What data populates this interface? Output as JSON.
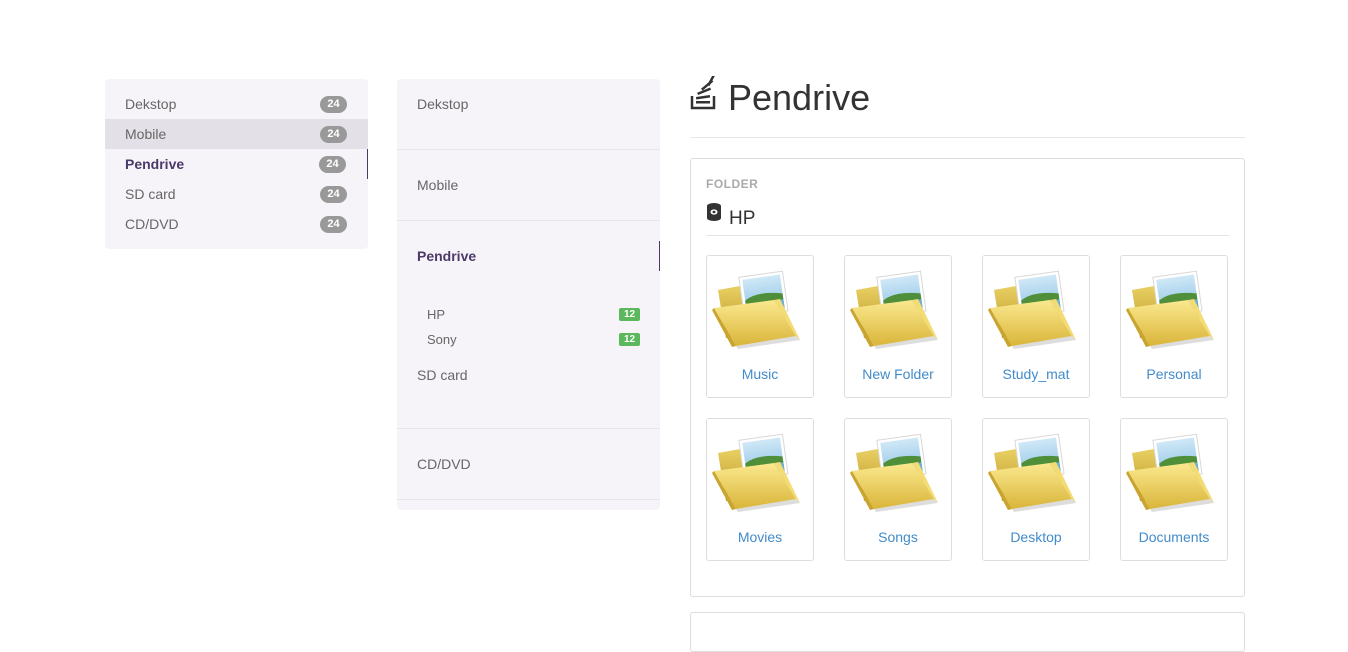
{
  "nav_primary": {
    "items": [
      {
        "label": "Dekstop",
        "badge": "24"
      },
      {
        "label": "Mobile",
        "badge": "24"
      },
      {
        "label": "Pendrive",
        "badge": "24"
      },
      {
        "label": "SD card",
        "badge": "24"
      },
      {
        "label": "CD/DVD",
        "badge": "24"
      }
    ]
  },
  "nav_secondary": {
    "items": [
      {
        "label": "Dekstop"
      },
      {
        "label": "Mobile"
      },
      {
        "label": "Pendrive"
      },
      {
        "label": "SD card"
      },
      {
        "label": "CD/DVD"
      }
    ],
    "subitems": [
      {
        "label": "HP",
        "badge": "12"
      },
      {
        "label": "Sony",
        "badge": "12"
      }
    ]
  },
  "page": {
    "title": "Pendrive",
    "title_icon": "stack-icon"
  },
  "folder_panel": {
    "label": "FOLDER",
    "heading": "HP",
    "heading_icon": "database-icon",
    "folders": [
      {
        "label": "Music"
      },
      {
        "label": "New Folder"
      },
      {
        "label": "Study_mat"
      },
      {
        "label": "Personal"
      },
      {
        "label": "Movies"
      },
      {
        "label": "Songs"
      },
      {
        "label": "Desktop"
      },
      {
        "label": "Documents"
      }
    ]
  },
  "colors": {
    "accent": "#4b3a67",
    "link": "#428bca",
    "badge_gray": "#999999",
    "badge_green": "#5cb85c",
    "nav_bg": "#f6f4f9"
  }
}
